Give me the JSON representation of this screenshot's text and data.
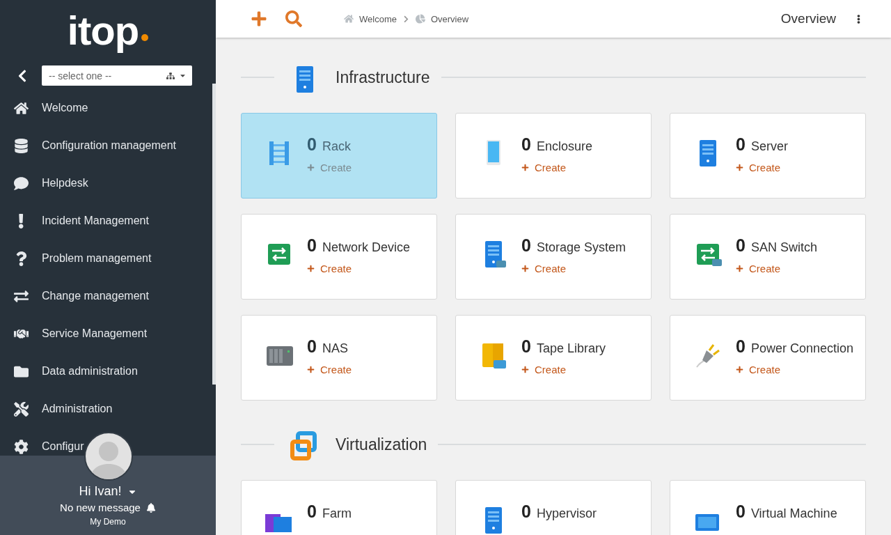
{
  "logo": {
    "text": "itop"
  },
  "sidebar": {
    "org_select": {
      "placeholder": "-- select one --"
    },
    "items": [
      {
        "label": "Welcome",
        "kind": "home"
      },
      {
        "label": "Configuration management",
        "kind": "database"
      },
      {
        "label": "Helpdesk",
        "kind": "comment"
      },
      {
        "label": "Incident Management",
        "kind": "exclamation"
      },
      {
        "label": "Problem management",
        "kind": "question"
      },
      {
        "label": "Change management",
        "kind": "exchange"
      },
      {
        "label": "Service Management",
        "kind": "handshake"
      },
      {
        "label": "Data administration",
        "kind": "folder"
      },
      {
        "label": "Administration",
        "kind": "tools"
      },
      {
        "label": "Configur",
        "kind": "gear"
      }
    ],
    "user": {
      "greeting": "Hi Ivan!",
      "messages": "No new message",
      "org": "My Demo"
    }
  },
  "top_bar": {
    "breadcrumbs": [
      {
        "label": "Welcome",
        "kind": "home"
      },
      {
        "label": "Overview",
        "kind": "pie"
      }
    ],
    "page_title": "Overview"
  },
  "sections": [
    {
      "title": "Infrastructure",
      "kind": "server",
      "cards": [
        {
          "count": "0",
          "name": "Rack",
          "action": "Create",
          "kind": "rack",
          "selected": true
        },
        {
          "count": "0",
          "name": "Enclosure",
          "action": "Create",
          "kind": "enclosure",
          "selected": false
        },
        {
          "count": "0",
          "name": "Server",
          "action": "Create",
          "kind": "server",
          "selected": false
        },
        {
          "count": "0",
          "name": "Network Device",
          "action": "Create",
          "kind": "network",
          "selected": false
        },
        {
          "count": "0",
          "name": "Storage System",
          "action": "Create",
          "kind": "storage",
          "selected": false
        },
        {
          "count": "0",
          "name": "SAN Switch",
          "action": "Create",
          "kind": "san",
          "selected": false
        },
        {
          "count": "0",
          "name": "NAS",
          "action": "Create",
          "kind": "nas",
          "selected": false
        },
        {
          "count": "0",
          "name": "Tape Library",
          "action": "Create",
          "kind": "tape",
          "selected": false
        },
        {
          "count": "0",
          "name": "Power Connection",
          "action": "Create",
          "kind": "power",
          "selected": false
        }
      ]
    },
    {
      "title": "Virtualization",
      "kind": "virtual",
      "cards": [
        {
          "count": "0",
          "name": "Farm",
          "kind": "farm",
          "selected": false
        },
        {
          "count": "0",
          "name": "Hypervisor",
          "kind": "hypervisor",
          "selected": false
        },
        {
          "count": "0",
          "name": "Virtual Machine",
          "kind": "vm",
          "selected": false
        }
      ]
    }
  ]
}
